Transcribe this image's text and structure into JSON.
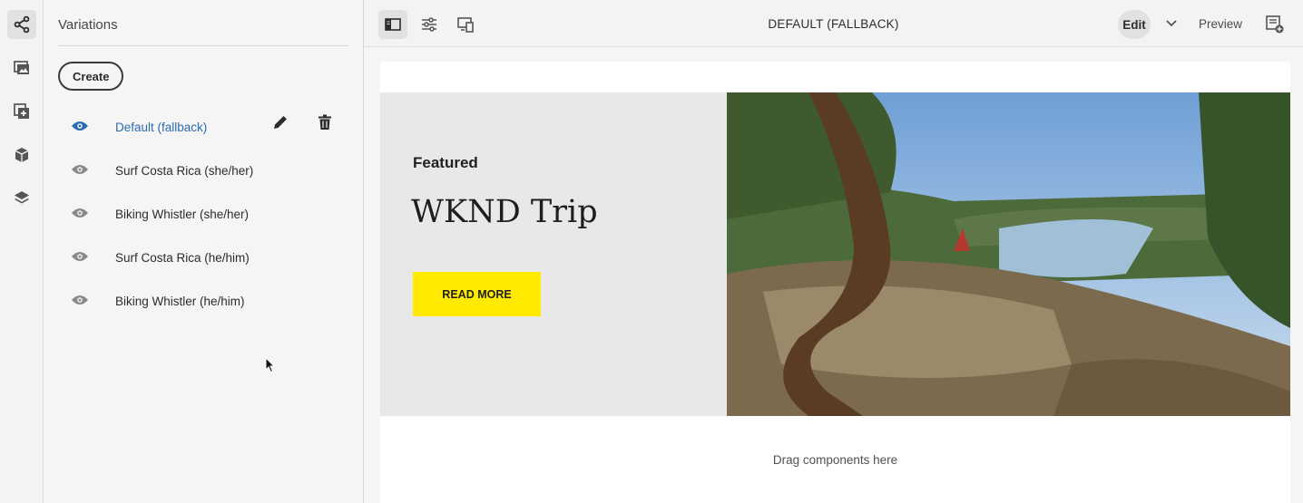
{
  "rail": {
    "icons": [
      "variations-icon",
      "image-gallery-icon",
      "add-asset-icon",
      "box-icon",
      "layers-icon"
    ]
  },
  "panel": {
    "title": "Variations",
    "create_label": "Create",
    "items": [
      {
        "label": "Default (fallback)",
        "selected": true
      },
      {
        "label": "Surf Costa Rica (she/her)",
        "selected": false
      },
      {
        "label": "Biking Whistler (she/her)",
        "selected": false
      },
      {
        "label": "Surf Costa Rica (he/him)",
        "selected": false
      },
      {
        "label": "Biking Whistler (he/him)",
        "selected": false
      }
    ]
  },
  "toolbar": {
    "title": "DEFAULT (FALLBACK)",
    "edit_label": "Edit",
    "preview_label": "Preview"
  },
  "teaser": {
    "label": "Featured",
    "title": "WKND Trip",
    "cta_label": "READ MORE"
  },
  "drop_zone": {
    "text": "Drag components here"
  },
  "colors": {
    "accent_blue": "#2b6cb0",
    "cta_yellow": "#ffea00"
  }
}
